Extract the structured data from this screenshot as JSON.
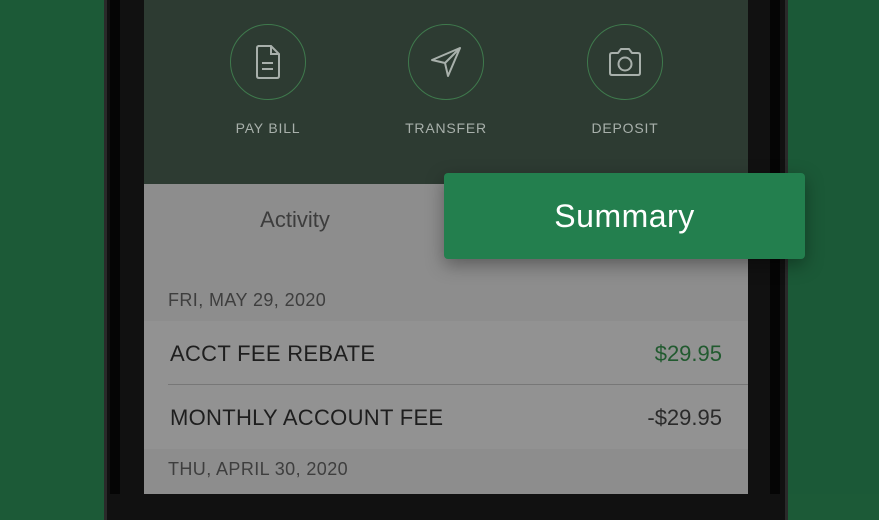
{
  "quick_actions": [
    {
      "label": "PAY BILL",
      "icon": "document-icon"
    },
    {
      "label": "TRANSFER",
      "icon": "paper-plane-icon"
    },
    {
      "label": "DEPOSIT",
      "icon": "camera-icon"
    }
  ],
  "tabs": {
    "activity_label": "Activity",
    "summary_label": "Summary"
  },
  "transactions": {
    "groups": [
      {
        "date": "FRI, MAY 29, 2020",
        "items": [
          {
            "name": "ACCT FEE REBATE",
            "amount": "$29.95"
          },
          {
            "name": "MONTHLY ACCOUNT FEE",
            "amount": "-$29.95"
          }
        ]
      },
      {
        "date": "THU, APRIL 30, 2020",
        "items": []
      }
    ]
  },
  "colors": {
    "background": "#1c5a37",
    "summary_button": "#237f4e",
    "positive_amount": "#215a2f",
    "action_panel": "#2d3b32"
  }
}
